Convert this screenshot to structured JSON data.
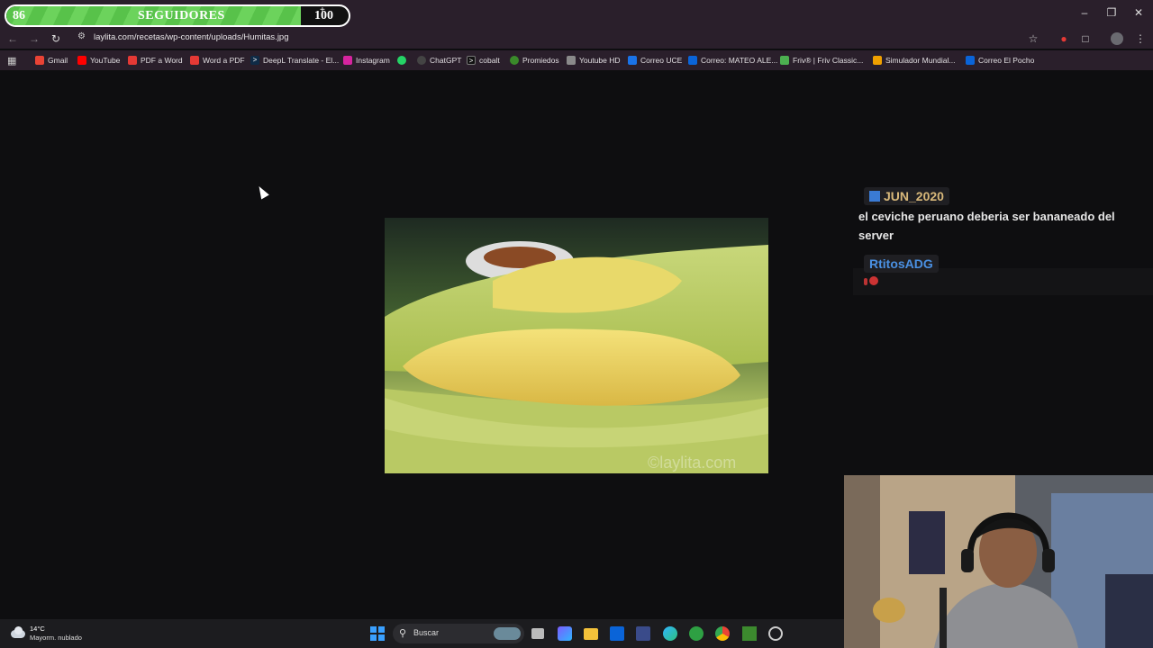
{
  "follower_goal": {
    "current": "86",
    "label": "SEGUIDORES",
    "goal": "100",
    "plus": "+",
    "progress_fraction": 0.86
  },
  "browser": {
    "url": "laylita.com/recetas/wp-content/uploads/Humitas.jpg",
    "bookmarks": [
      {
        "label": "Gmail",
        "icon": "gmail-icon",
        "color": "#ea4335"
      },
      {
        "label": "YouTube",
        "icon": "youtube-icon",
        "color": "#ff0000"
      },
      {
        "label": "PDF a Word",
        "icon": "pdf-icon",
        "color": "#e53935"
      },
      {
        "label": "Word a PDF",
        "icon": "pdf-icon",
        "color": "#e53935"
      },
      {
        "label": "DeepL Translate - El...",
        "icon": "deepl-icon",
        "color": "#0f2b46"
      },
      {
        "label": "Instagram",
        "icon": "instagram-icon",
        "color": "#d6249f"
      },
      {
        "label": "",
        "icon": "whatsapp-icon",
        "color": "#25d366"
      },
      {
        "label": "ChatGPT",
        "icon": "chatgpt-icon",
        "color": "#444"
      },
      {
        "label": "cobalt",
        "icon": "cobalt-icon",
        "color": "#111"
      },
      {
        "label": "Promiedos",
        "icon": "promiedos-icon",
        "color": "#3a8a2a"
      },
      {
        "label": "Youtube HD",
        "icon": "youtube-hd-icon",
        "color": "#8a8a8a"
      },
      {
        "label": "Correo UCE",
        "icon": "mail-icon",
        "color": "#1a73e8"
      },
      {
        "label": "Correo: MATEO ALE...",
        "icon": "outlook-icon",
        "color": "#0a64d8"
      },
      {
        "label": "Friv® | Friv Classic...",
        "icon": "friv-icon",
        "color": "#4caf50"
      },
      {
        "label": "Simulador Mundial...",
        "icon": "simulator-icon",
        "color": "#f0a000"
      },
      {
        "label": "Correo El Pocho",
        "icon": "outlook-icon",
        "color": "#0a64d8"
      }
    ]
  },
  "chat": {
    "messages": [
      {
        "user": "JUN_2020",
        "user_color": "#d8b87a",
        "text": "el ceviche peruano deberia ser bananeado del server"
      },
      {
        "user": "RtitosADG",
        "user_color": "#4a90e2",
        "text": ""
      }
    ]
  },
  "photo": {
    "watermark": "©laylita.com"
  },
  "taskbar": {
    "weather_temp": "14°C",
    "weather_desc": "Mayorm. nublado",
    "search_placeholder": "Buscar"
  }
}
